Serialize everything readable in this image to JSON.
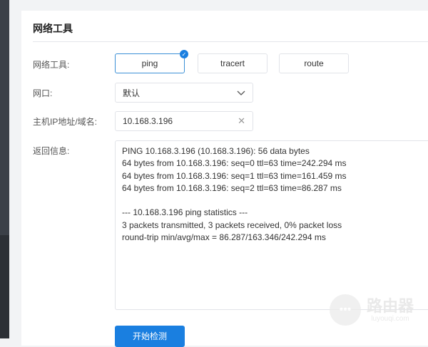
{
  "page": {
    "title": "网络工具"
  },
  "form": {
    "tool_label": "网络工具:",
    "tools": [
      {
        "label": "ping",
        "selected": true
      },
      {
        "label": "tracert",
        "selected": false
      },
      {
        "label": "route",
        "selected": false
      }
    ],
    "interface_label": "网口:",
    "interface_value": "默认",
    "host_label": "主机IP地址/域名:",
    "host_value": "10.168.3.196",
    "output_label": "返回信息:",
    "output_text": "PING 10.168.3.196 (10.168.3.196): 56 data bytes\n64 bytes from 10.168.3.196: seq=0 ttl=63 time=242.294 ms\n64 bytes from 10.168.3.196: seq=1 ttl=63 time=161.459 ms\n64 bytes from 10.168.3.196: seq=2 ttl=63 time=86.287 ms\n\n--- 10.168.3.196 ping statistics ---\n3 packets transmitted, 3 packets received, 0% packet loss\nround-trip min/avg/max = 86.287/163.346/242.294 ms",
    "start_label": "开始检测"
  },
  "watermark": {
    "name": "路由器",
    "site": "luyouqi.com"
  }
}
